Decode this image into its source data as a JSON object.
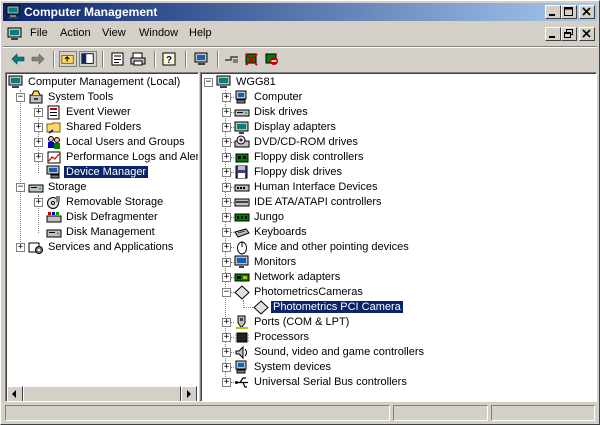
{
  "window": {
    "title": "Computer Management"
  },
  "menu": {
    "file": "File",
    "action": "Action",
    "view": "View",
    "window": "Window",
    "help": "Help"
  },
  "left_tree": {
    "root": "Computer Management (Local)",
    "system_tools": "System Tools",
    "event_viewer": "Event Viewer",
    "shared_folders": "Shared Folders",
    "local_users": "Local Users and Groups",
    "perf_logs": "Performance Logs and Alerts",
    "device_manager": "Device Manager",
    "storage": "Storage",
    "removable_storage": "Removable Storage",
    "disk_defrag": "Disk Defragmenter",
    "disk_mgmt": "Disk Management",
    "services": "Services and Applications"
  },
  "right_tree": {
    "root": "WGG81",
    "items": [
      "Computer",
      "Disk drives",
      "Display adapters",
      "DVD/CD-ROM drives",
      "Floppy disk controllers",
      "Floppy disk drives",
      "Human Interface Devices",
      "IDE ATA/ATAPI controllers",
      "Jungo",
      "Keyboards",
      "Mice and other pointing devices",
      "Monitors",
      "Network adapters",
      "PhotometricsCameras",
      "Photometrics PCI Camera",
      "Ports (COM & LPT)",
      "Processors",
      "Sound, video and game controllers",
      "System devices",
      "Universal Serial Bus controllers"
    ]
  },
  "colors": {
    "titlebar_start": "#0a246a",
    "titlebar_end": "#a6caf0",
    "selection": "#0a246a",
    "face": "#d4d0c8"
  }
}
